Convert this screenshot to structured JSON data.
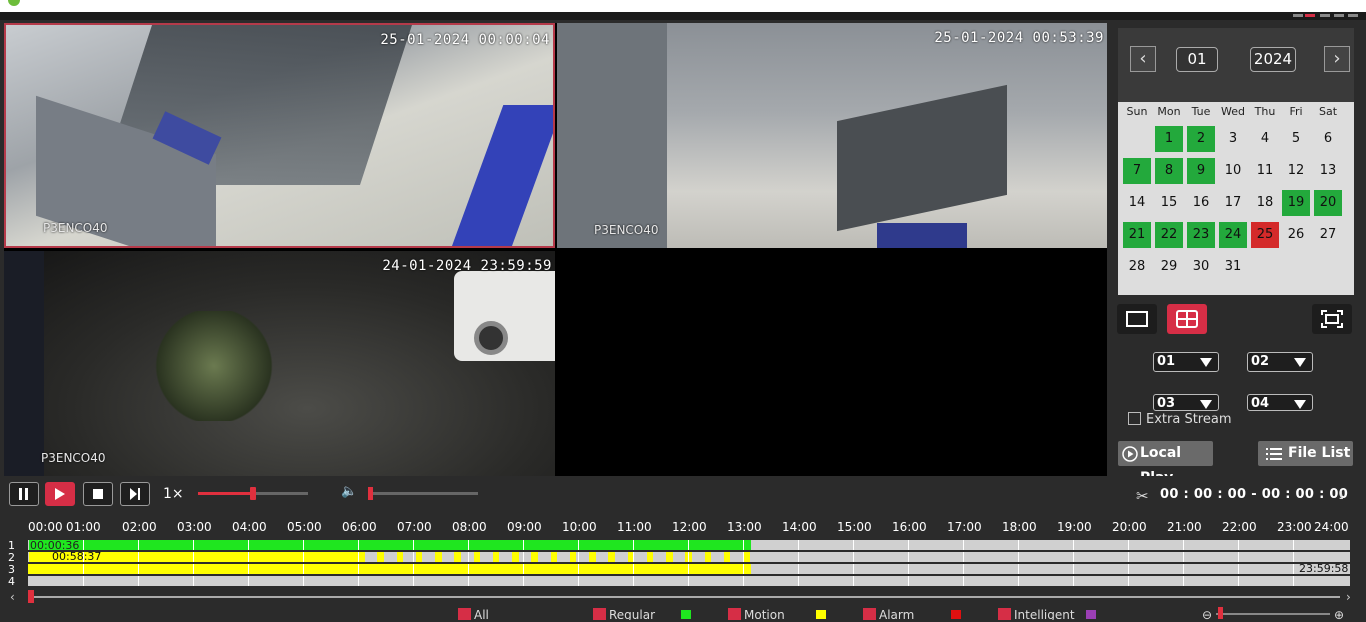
{
  "cameras": [
    {
      "timestamp": "25-01-2024 00:00:04",
      "name": "P3ENCO40"
    },
    {
      "timestamp": "25-01-2024 00:53:39",
      "name": "P3ENCO40"
    },
    {
      "timestamp": "24-01-2024 23:59:59",
      "name": "P3ENCO40"
    },
    {
      "timestamp": "",
      "name": ""
    }
  ],
  "calendar": {
    "month": "01",
    "year": "2024",
    "weekdays": [
      "Sun",
      "Mon",
      "Tue",
      "Wed",
      "Thu",
      "Fri",
      "Sat"
    ],
    "first_weekday": 1,
    "days_in_month": 31,
    "recorded_days": [
      1,
      2,
      7,
      8,
      9,
      19,
      20,
      21,
      22,
      23,
      24
    ],
    "selected_day": 25
  },
  "channels": {
    "ch1": "01",
    "ch2": "02",
    "ch3": "03",
    "ch4": "04"
  },
  "extra_stream_label": "Extra Stream",
  "buttons": {
    "local_play": "Local Play",
    "file_list": "File List"
  },
  "playback": {
    "speed": "1×",
    "progress": 0.5,
    "volume": 0.0,
    "clip_time": "00 : 00 : 00 - 00 : 00 : 00"
  },
  "timeline": {
    "hours": [
      "00:00",
      "01:00",
      "02:00",
      "03:00",
      "04:00",
      "05:00",
      "06:00",
      "07:00",
      "08:00",
      "09:00",
      "10:00",
      "11:00",
      "12:00",
      "13:00",
      "14:00",
      "15:00",
      "16:00",
      "17:00",
      "18:00",
      "19:00",
      "20:00",
      "21:00",
      "22:00",
      "23:00",
      "24:00"
    ],
    "rows": [
      "1",
      "2",
      "3",
      "4"
    ],
    "row1_start_label": "00:00:36",
    "row2_start_label": "00:58:37",
    "row3_end_label": "23:59:58"
  },
  "legend": {
    "all": "All",
    "regular": "Regular",
    "motion": "Motion",
    "alarm": "Alarm",
    "intelligent": "Intelligent"
  },
  "colors": {
    "accent": "#d62e46",
    "regular": "#1fe61f",
    "motion": "#ffff00",
    "alarm": "#e01010",
    "intelligent": "#9b3fb5",
    "calendar_recorded": "#23a93c",
    "calendar_today": "#d42a2a"
  }
}
